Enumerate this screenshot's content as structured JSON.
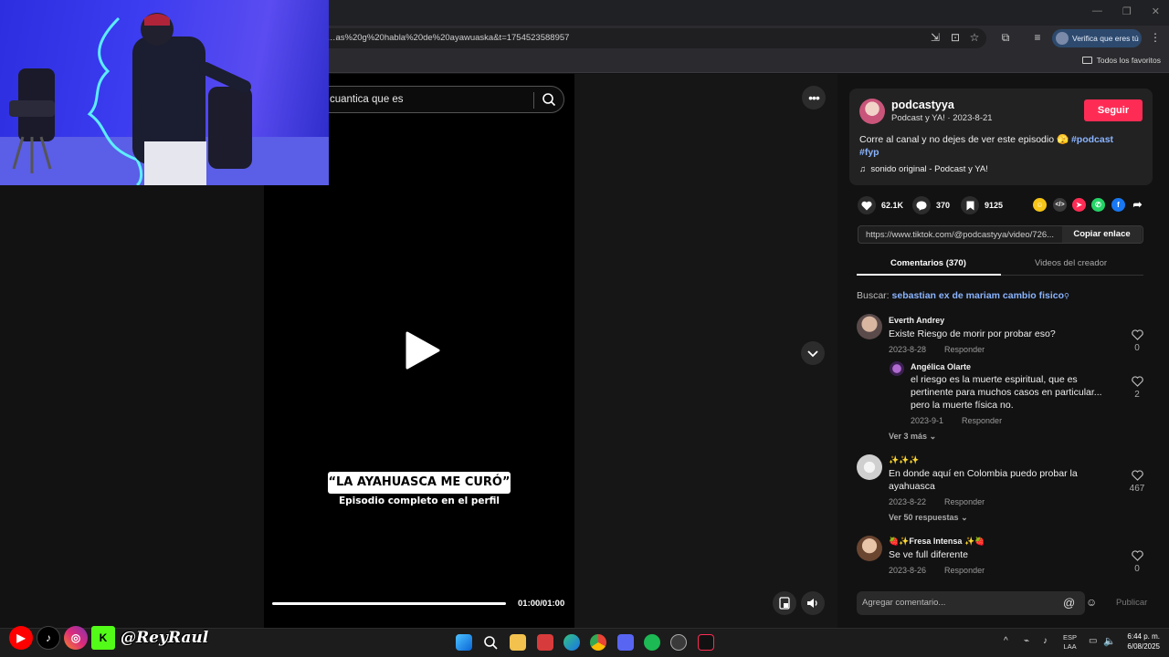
{
  "browser": {
    "url": "…as%20g%20habla%20de%20ayawuaska&t=1754523588957",
    "verify_label": "Verifica que eres tú",
    "favorites_label": "Todos los favoritos"
  },
  "video": {
    "search_text": "cuantica que es",
    "caption_title": "“LA AYAHUASCA ME CURÓ”",
    "caption_sub": "Episodio completo en el perfil",
    "time": "01:00/01:00",
    "progress": 1.0
  },
  "author": {
    "name": "podcastyya",
    "subtitle": "Podcast y YA! · 2023-8-21",
    "follow_label": "Seguir",
    "description": "Corre al canal y no dejes de ver este episodio 🫣 ",
    "hashtag1": "#podcast",
    "hashtag2": "#fyp",
    "sound": "sonido original - Podcast y YA!"
  },
  "stats": {
    "likes": "62.1K",
    "comments": "370",
    "saves": "9125"
  },
  "link": {
    "url": "https://www.tiktok.com/@podcastyya/video/726...",
    "copy_label": "Copiar enlace"
  },
  "tabs": {
    "comments": "Comentarios (370)",
    "creator_videos": "Videos del creador"
  },
  "search_hint": {
    "prefix": "Buscar: ",
    "query": "sebastian ex de mariam cambio fisico"
  },
  "comments": [
    {
      "name": "Everth Andrey",
      "text": "Existe Riesgo de morir por probar eso?",
      "date": "2023-8-28",
      "reply": "Responder",
      "likes": "0"
    },
    {
      "name": "Angélica Olarte",
      "text": "el riesgo es la muerte espiritual, que es pertinente para muchos casos en particular... pero la muerte física no.",
      "date": "2023-9-1",
      "reply": "Responder",
      "likes": "2"
    },
    {
      "name": "✨✨✨",
      "text": "En donde aquí en Colombia puedo probar la ayahuasca",
      "date": "2023-8-22",
      "reply": "Responder",
      "likes": "467"
    },
    {
      "name": "🍓✨Fresa Intensa ✨🍓",
      "text": "Se ve full diferente",
      "date": "2023-8-26",
      "reply": "Responder",
      "likes": "0"
    }
  ],
  "more_replies": [
    "Ver 3 más",
    "Ver 50 respuestas"
  ],
  "comment_input": {
    "placeholder": "Agregar comentario...",
    "publish": "Publicar"
  },
  "overlay": {
    "handle": "@ReyRaul"
  },
  "system": {
    "lang1": "ESP",
    "lang2": "LAA",
    "time": "6:44 p. m.",
    "date": "6/08/2025"
  },
  "colors": {
    "accent": "#fe2c55",
    "link": "#8ab4ff",
    "webcam": "#3c3cf0"
  }
}
